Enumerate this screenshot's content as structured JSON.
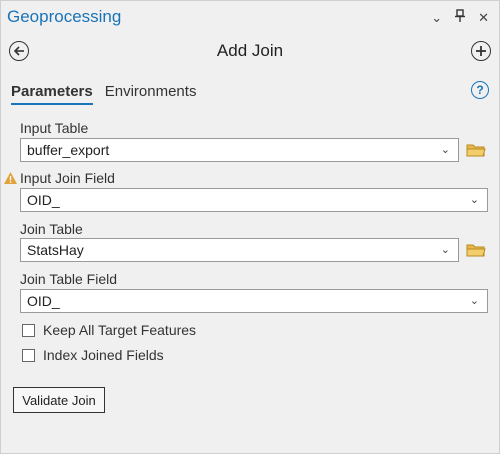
{
  "pane": {
    "title": "Geoprocessing",
    "controls": {
      "options": "⌄",
      "pin": "📌",
      "close": "✕"
    }
  },
  "tool": {
    "title": "Add Join"
  },
  "tabs": [
    {
      "label": "Parameters",
      "active": true
    },
    {
      "label": "Environments",
      "active": false
    }
  ],
  "help_symbol": "?",
  "params": {
    "input_table": {
      "label": "Input Table",
      "value": "buffer_export"
    },
    "input_join_field": {
      "label": "Input Join Field",
      "value": "OID_"
    },
    "join_table": {
      "label": "Join Table",
      "value": "StatsHay"
    },
    "join_table_field": {
      "label": "Join Table Field",
      "value": "OID_"
    }
  },
  "checkboxes": {
    "keep_all": {
      "label": "Keep All Target Features",
      "checked": false
    },
    "index_joined": {
      "label": "Index Joined Fields",
      "checked": false
    }
  },
  "buttons": {
    "validate": "Validate Join"
  },
  "colors": {
    "accent": "#1a74b8",
    "warning": "#e2a23b",
    "folder": "#e7b84a"
  }
}
